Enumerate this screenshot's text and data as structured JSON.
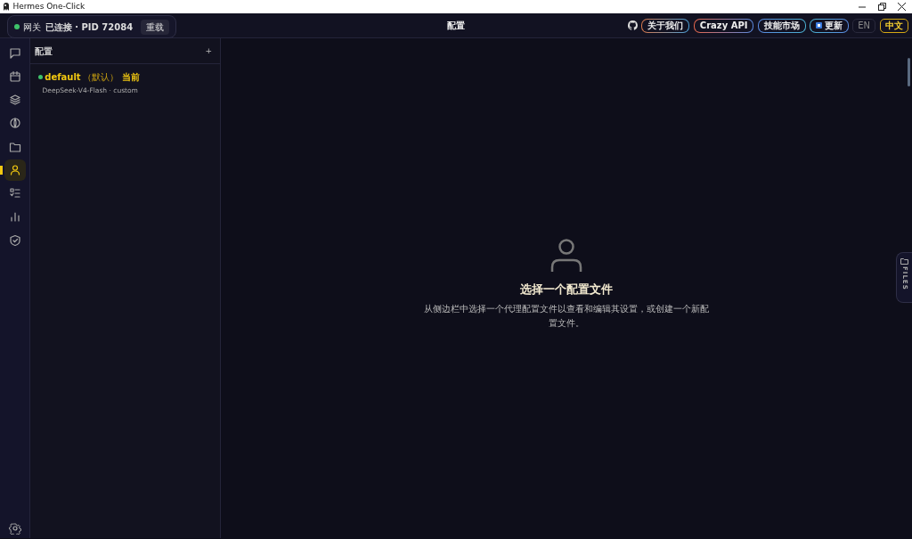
{
  "window": {
    "title": "Hermes One-Click"
  },
  "gateway": {
    "label": "网关",
    "status": "已连接 · PID 72084",
    "connected": true,
    "button": "重载"
  },
  "header": {
    "title": "配置",
    "links": [
      "关于我们",
      "Crazy API",
      "技能市场"
    ],
    "update_button": "更新",
    "languages": [
      {
        "label": "EN",
        "selected": false
      },
      {
        "label": "中文",
        "selected": true
      }
    ]
  },
  "nav_items": [
    {
      "selected": false
    },
    {
      "selected": false
    },
    {
      "selected": false
    },
    {
      "selected": false
    },
    {
      "selected": false
    },
    {
      "selected": true
    },
    {
      "selected": false
    },
    {
      "selected": false
    },
    {
      "selected": false
    }
  ],
  "sidebar": {
    "title": "配置",
    "add_button": "+",
    "profiles": [
      {
        "name": "default",
        "tag": "（默认）",
        "badge": "当前",
        "detail": "DeepSeek-V4-Flash · custom",
        "online": true
      }
    ]
  },
  "empty_state": {
    "title": "选择一个配置文件",
    "text": "从侧边栏中选择一个代理配置文件以查看和编辑其设置，或创建一个新配置文件。"
  },
  "files_tab": {
    "label": "FILES"
  }
}
